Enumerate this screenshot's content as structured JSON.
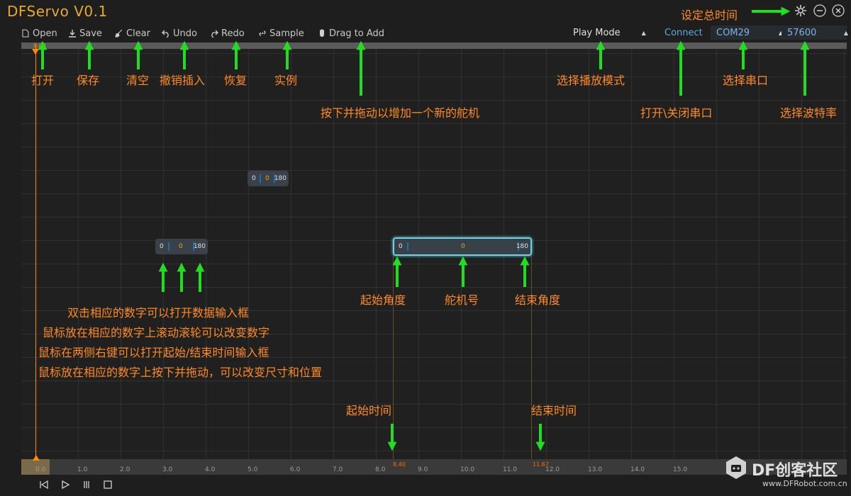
{
  "app": {
    "title": "DFServo V0.1"
  },
  "toolbar": {
    "open": "Open",
    "save": "Save",
    "clear": "Clear",
    "undo": "Undo",
    "redo": "Redo",
    "sample": "Sample",
    "drag_to_add": "Drag to Add"
  },
  "controls": {
    "play_mode": "Play Mode",
    "connect": "Connect",
    "com_port": "COM29",
    "baud_rate": "57600"
  },
  "timeline": {
    "cursor_time": "0.00",
    "ticks": [
      "0.0",
      "1.0",
      "2.0",
      "3.0",
      "4.0",
      "5.0",
      "6.0",
      "7.0",
      "8.0",
      "9.0",
      "10.0",
      "11.0",
      "12.0",
      "13.0",
      "14.0",
      "15.0"
    ],
    "start_marker": "8.40",
    "end_marker": "11.67"
  },
  "servos": [
    {
      "start_angle": "0",
      "servo_id": "0",
      "end_angle": "180"
    },
    {
      "start_angle": "0",
      "servo_id": "0",
      "end_angle": "180"
    },
    {
      "start_angle": "0",
      "servo_id": "0",
      "end_angle": "180"
    }
  ],
  "annotations": {
    "set_total_time": "设定总时间",
    "open": "打开",
    "save": "保存",
    "clear": "清空",
    "undo_insert": "撤销插入",
    "redo": "恢复",
    "sample": "实例",
    "drag_add": "按下并拖动以增加一个新的舵机",
    "play_mode": "选择播放模式",
    "toggle_port": "打开\\关闭串口",
    "select_port": "选择串口",
    "select_baud": "选择波特率",
    "start_angle": "起始角度",
    "servo_id": "舵机号",
    "end_angle": "结束角度",
    "tip1": "双击相应的数字可以打开数据输入框",
    "tip2": "鼠标放在相应的数字上滚动滚轮可以改变数字",
    "tip3": "鼠标在两侧右键可以打开起始/结束时间输入框",
    "tip4": "鼠标放在相应的数字上按下并拖动，可以改变尺寸和位置",
    "start_time": "起始时间",
    "end_time": "结束时间"
  },
  "watermark": {
    "brand": "DF创客社区",
    "url": "www.DFRobot.com.cn"
  },
  "colors": {
    "accent_orange": "#ff8a1e",
    "arrow_green": "#22dd22",
    "link_blue": "#5fa8e0",
    "selected_cyan": "#6fd0e0"
  }
}
